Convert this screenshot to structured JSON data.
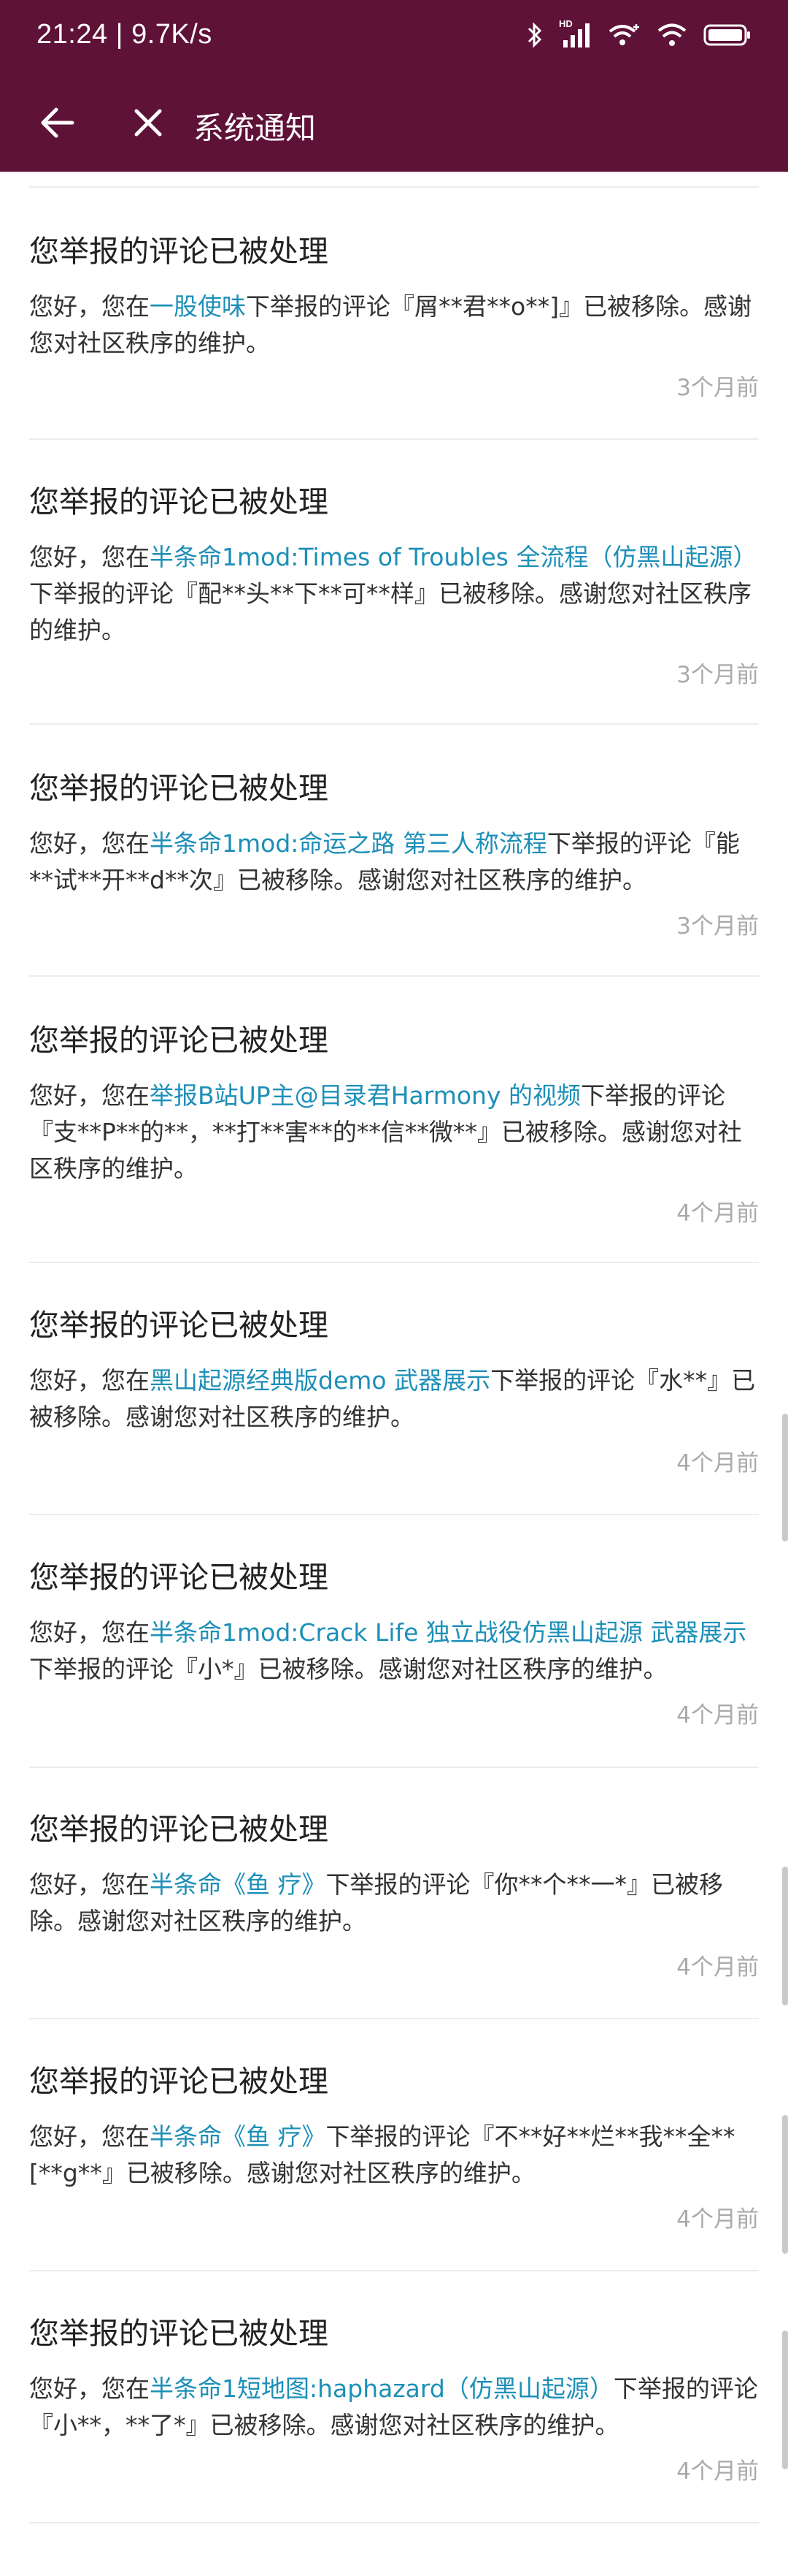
{
  "status": {
    "time": "21:24 | 9.7K/s",
    "network_badge": "HD",
    "battery_icon": "battery-icon"
  },
  "appbar": {
    "title": "系统通知",
    "bg_color": "#5e1237"
  },
  "notifications": [
    {
      "title": "您举报的评论已被处理",
      "prefix": "您好，您在",
      "link": "一股使味",
      "suffix": "下举报的评论『屑**君**o**]』已被移除。感谢您对社区秩序的维护。",
      "time": "3个月前"
    },
    {
      "title": "您举报的评论已被处理",
      "prefix": "您好，您在",
      "link": "半条命1mod:Times of Troubles 全流程（仿黑山起源）",
      "suffix": "下举报的评论『配**头**下**可**样』已被移除。感谢您对社区秩序的维护。",
      "time": "3个月前"
    },
    {
      "title": "您举报的评论已被处理",
      "prefix": "您好，您在",
      "link": "半条命1mod:命运之路 第三人称流程",
      "suffix": "下举报的评论『能**试**开**d**次』已被移除。感谢您对社区秩序的维护。",
      "time": "3个月前"
    },
    {
      "title": "您举报的评论已被处理",
      "prefix": "您好，您在",
      "link": "举报B站UP主@目录君Harmony 的视频",
      "suffix": "下举报的评论『支**P**的**，**打**害**的**信**微**』已被移除。感谢您对社区秩序的维护。",
      "time": "4个月前"
    },
    {
      "title": "您举报的评论已被处理",
      "prefix": "您好，您在",
      "link": "黑山起源经典版demo 武器展示",
      "suffix": "下举报的评论『水**』已被移除。感谢您对社区秩序的维护。",
      "time": "4个月前"
    },
    {
      "title": "您举报的评论已被处理",
      "prefix": "您好，您在",
      "link": "半条命1mod:Crack Life 独立战役仿黑山起源 武器展示",
      "suffix": "下举报的评论『小*』已被移除。感谢您对社区秩序的维护。",
      "time": "4个月前"
    },
    {
      "title": "您举报的评论已被处理",
      "prefix": "您好，您在",
      "link": "半条命《鱼 疗》",
      "suffix": "下举报的评论『你**个**一*』已被移除。感谢您对社区秩序的维护。",
      "time": "4个月前"
    },
    {
      "title": "您举报的评论已被处理",
      "prefix": "您好，您在",
      "link": "半条命《鱼 疗》",
      "suffix": "下举报的评论『不**好**烂**我**全**[**g**』已被移除。感谢您对社区秩序的维护。",
      "time": "4个月前"
    },
    {
      "title": "您举报的评论已被处理",
      "prefix": "您好，您在",
      "link": "半条命1短地图:haphazard（仿黑山起源）",
      "suffix": "下举报的评论『小**，**了*』已被移除。感谢您对社区秩序的维护。",
      "time": "4个月前"
    }
  ]
}
